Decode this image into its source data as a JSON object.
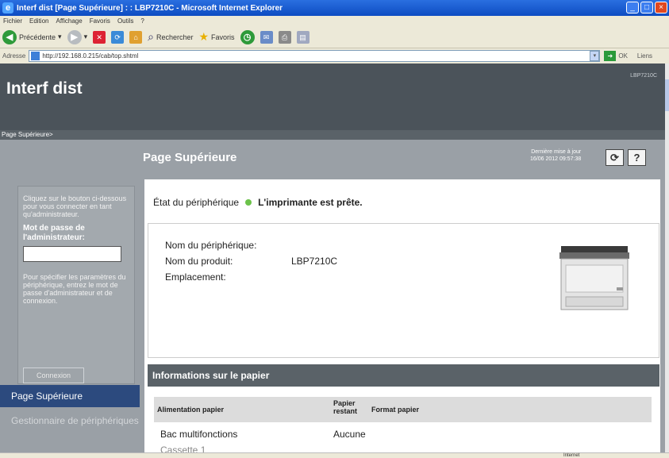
{
  "window": {
    "title": "Interf dist [Page Supérieure] : : LBP7210C - Microsoft Internet Explorer"
  },
  "menu": [
    "Fichier",
    "Edition",
    "Affichage",
    "Favoris",
    "Outils",
    "?"
  ],
  "toolbar": {
    "back": "Précédente",
    "search": "Rechercher",
    "favorites": "Favoris"
  },
  "address": {
    "label": "Adresse",
    "url": "http://192.168.0.215/cab/top.shtml",
    "go": "OK",
    "links": "Liens"
  },
  "header": {
    "logo": "Interf dist",
    "model": "LBP7210C"
  },
  "breadcrumb": "Page Supérieure>",
  "page": {
    "title": "Page Supérieure",
    "last_update_label": "Dernière mise à jour",
    "last_update": "16/06 2012 09:57:38"
  },
  "sidebar": {
    "intro": "Cliquez sur le bouton ci-dessous pour vous connecter en tant qu'administrateur.",
    "password_label": "Mot de passe de l'administrateur:",
    "hint": "Pour spécifier les paramètres du périphérique, entrez le mot de passe d'administrateur et de connexion.",
    "login": "Connexion",
    "nav_active": "Page Supérieure",
    "nav_other": "Gestionnaire de périphériques"
  },
  "status": {
    "label": "État du périphérique",
    "message": "L'imprimante est prête.",
    "color": "#6cc24a"
  },
  "device": {
    "name_label": "Nom du périphérique:",
    "product_label": "Nom du produit:",
    "product_value": "LBP7210C",
    "location_label": "Emplacement:"
  },
  "paper": {
    "section": "Informations sur le papier",
    "col_source": "Alimentation papier",
    "col_remaining": "Papier restant",
    "col_format": "Format papier",
    "rows": [
      {
        "source": "Bac multifonctions",
        "remaining": "Aucune",
        "format": ""
      }
    ],
    "row2_partial": "Cassette 1"
  },
  "statusbar": {
    "zone": "Internet"
  }
}
